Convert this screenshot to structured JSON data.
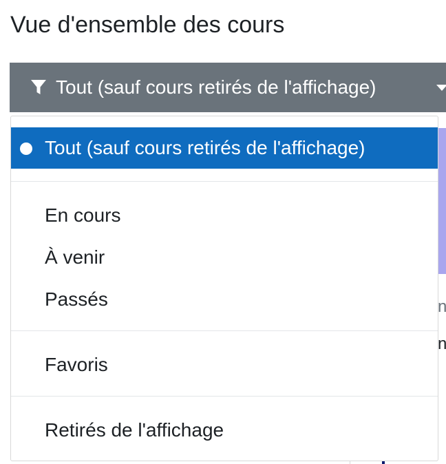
{
  "header": {
    "title": "Vue d'ensemble des cours"
  },
  "filter": {
    "icon": "filter-icon",
    "selected_label": "Tout (sauf cours retirés de l'affichage)",
    "button_color": "#6a737b"
  },
  "menu": {
    "active_color": "#0f6cbf",
    "items": [
      {
        "label": "Tout (sauf cours retirés de l'affichage)",
        "selected": true
      },
      {
        "label": "En cours",
        "selected": false
      },
      {
        "label": "À venir",
        "selected": false
      },
      {
        "label": "Passés",
        "selected": false
      },
      {
        "label": "Favoris",
        "selected": false
      },
      {
        "label": "Retirés de l'affichage",
        "selected": false
      }
    ]
  },
  "background": {
    "partial_text_1": "nt",
    "partial_text_2": "nt"
  }
}
